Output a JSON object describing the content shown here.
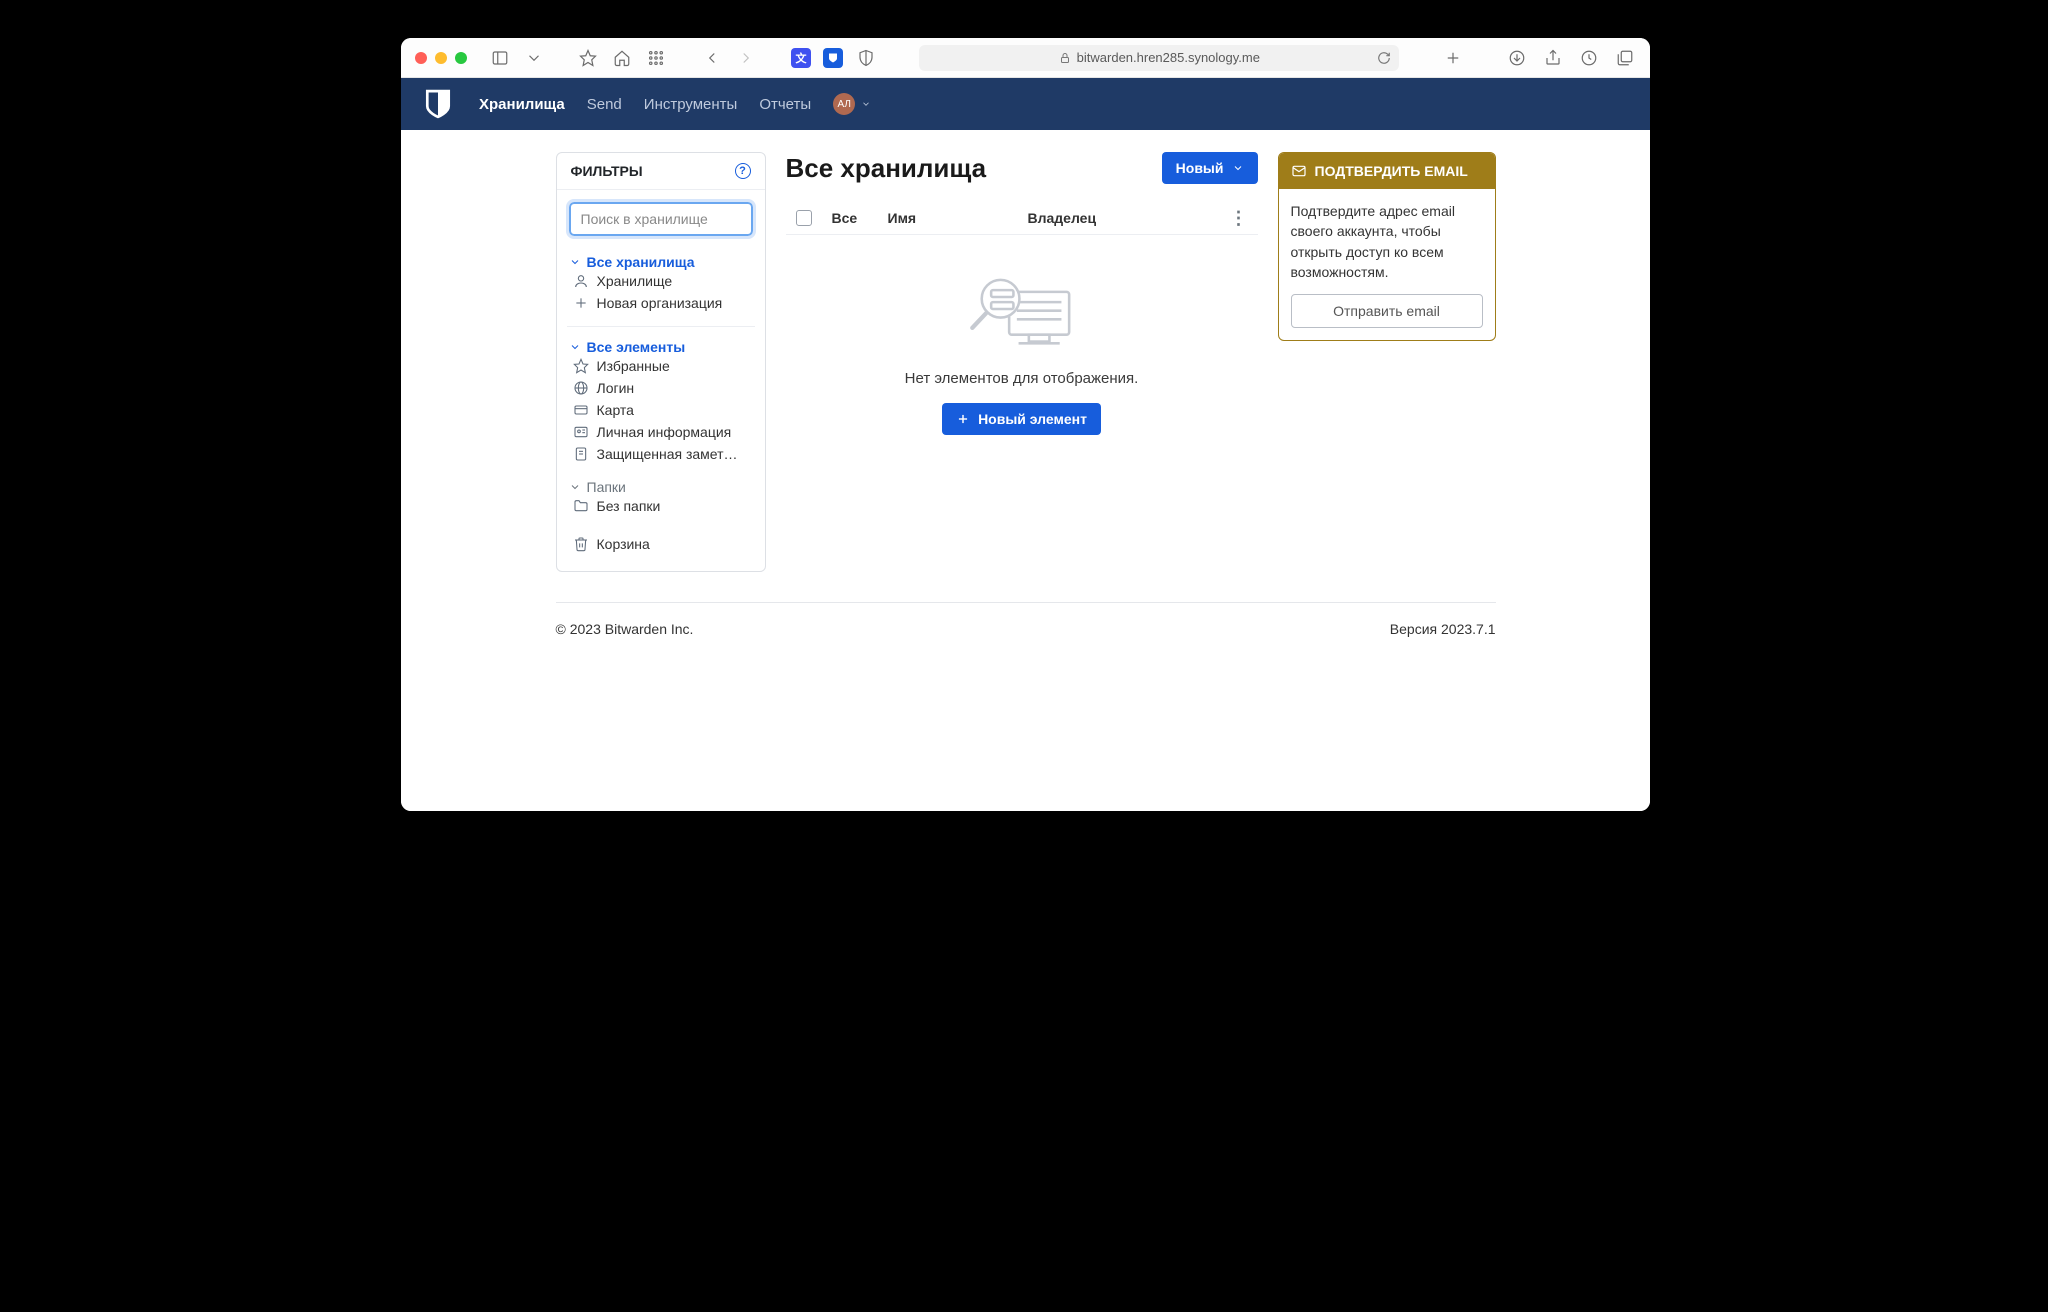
{
  "browser": {
    "url": "bitwarden.hren285.synology.me"
  },
  "nav": {
    "items": [
      "Хранилища",
      "Send",
      "Инструменты",
      "Отчеты"
    ],
    "avatar": "АЛ"
  },
  "sidebar": {
    "title": "ФИЛЬТРЫ",
    "search_placeholder": "Поиск в хранилище",
    "vaults": {
      "header": "Все хранилища",
      "items": [
        "Хранилище",
        "Новая организация"
      ]
    },
    "elements": {
      "header": "Все элементы",
      "items": [
        "Избранные",
        "Логин",
        "Карта",
        "Личная информация",
        "Защищенная замет…"
      ]
    },
    "folders": {
      "header": "Папки",
      "items": [
        "Без папки"
      ]
    },
    "trash": "Корзина"
  },
  "main": {
    "title": "Все хранилища",
    "new_btn": "Новый",
    "cols": {
      "all": "Все",
      "name": "Имя",
      "owner": "Владелец"
    },
    "empty_text": "Нет элементов для отображения.",
    "new_item_btn": "Новый элемент"
  },
  "callout": {
    "title": "ПОДТВЕРДИТЬ EMAIL",
    "body": "Подтвердите адрес email своего аккаунта, чтобы открыть доступ ко всем возможностям.",
    "button": "Отправить email"
  },
  "footer": {
    "copyright": "© 2023 Bitwarden Inc.",
    "version": "Версия 2023.7.1"
  }
}
